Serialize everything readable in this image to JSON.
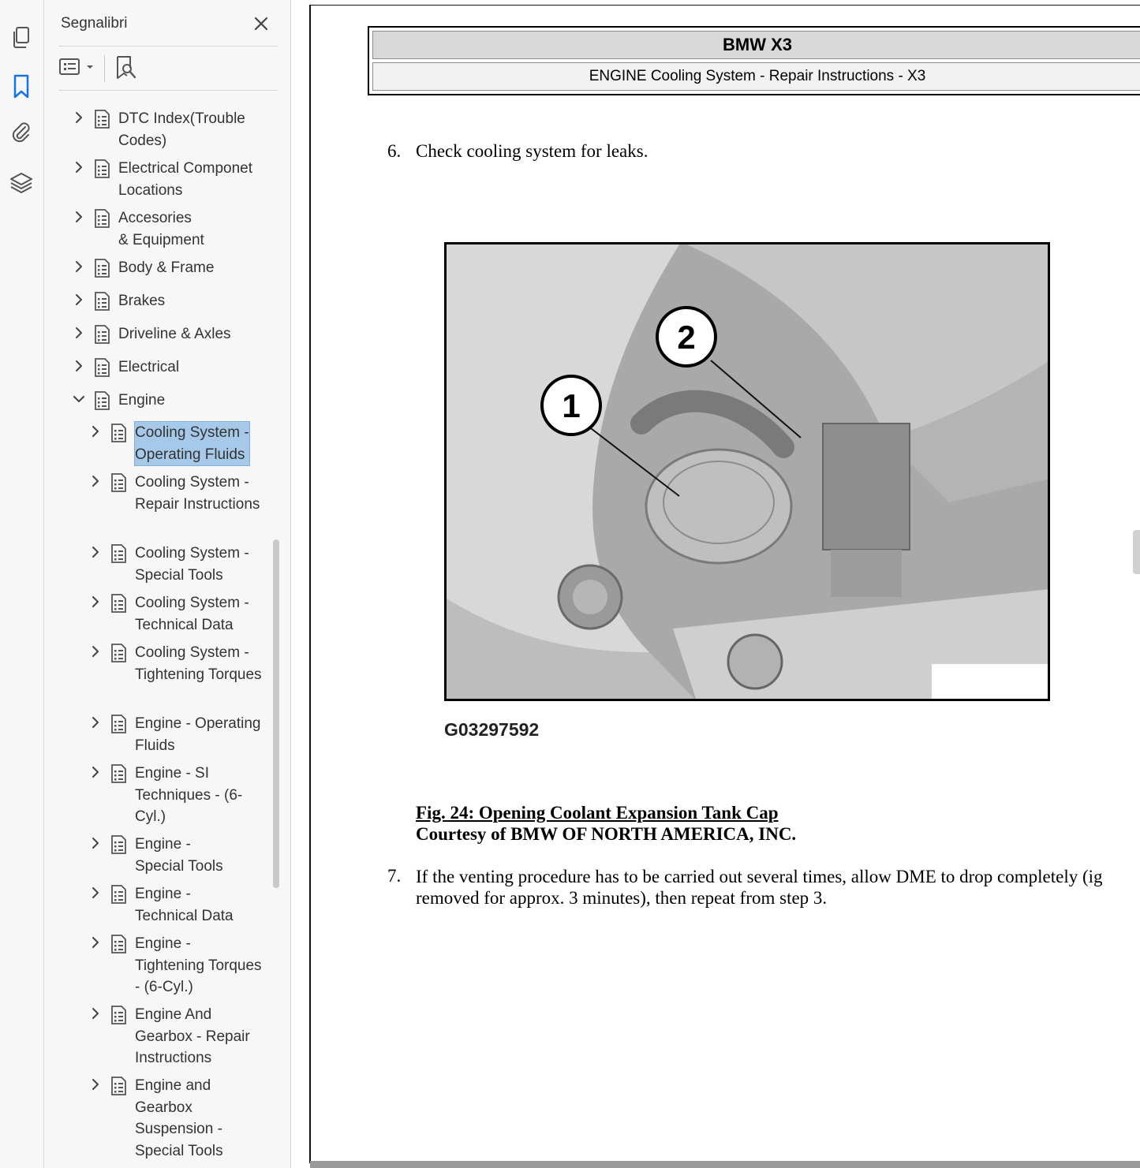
{
  "bookmarks_panel": {
    "title": "Segnalibri",
    "items": [
      {
        "label": "DTC Index(Trouble\nCodes)",
        "expanded": false,
        "selected": false
      },
      {
        "label": "Electrical Componet\nLocations",
        "expanded": false,
        "selected": false
      },
      {
        "label": "Accesories\n& Equipment",
        "expanded": false,
        "selected": false
      },
      {
        "label": "Body & Frame",
        "expanded": false,
        "selected": false
      },
      {
        "label": "Brakes",
        "expanded": false,
        "selected": false
      },
      {
        "label": "Driveline & Axles",
        "expanded": false,
        "selected": false
      },
      {
        "label": "Electrical",
        "expanded": false,
        "selected": false
      },
      {
        "label": "Engine",
        "expanded": true,
        "selected": false
      },
      {
        "label": "Cooling System -\nOperating Fluids",
        "expanded": false,
        "selected": true
      },
      {
        "label": "Cooling System -\nRepair Instructions",
        "expanded": false,
        "selected": false
      },
      {
        "label": "Cooling System -\nSpecial Tools",
        "expanded": false,
        "selected": false
      },
      {
        "label": "Cooling System -\nTechnical Data",
        "expanded": false,
        "selected": false
      },
      {
        "label": "Cooling System -\nTightening Torques",
        "expanded": false,
        "selected": false
      },
      {
        "label": "Engine - Operating\nFluids",
        "expanded": false,
        "selected": false
      },
      {
        "label": "Engine - SI\nTechniques - (6-\nCyl.)",
        "expanded": false,
        "selected": false
      },
      {
        "label": "Engine -\nSpecial Tools",
        "expanded": false,
        "selected": false
      },
      {
        "label": "Engine -\nTechnical Data",
        "expanded": false,
        "selected": false
      },
      {
        "label": "Engine -\nTightening Torques\n- (6-Cyl.)",
        "expanded": false,
        "selected": false
      },
      {
        "label": "Engine And\nGearbox - Repair\nInstructions",
        "expanded": false,
        "selected": false
      },
      {
        "label": "Engine and\nGearbox\nSuspension -\nSpecial Tools",
        "expanded": false,
        "selected": false
      }
    ]
  },
  "document": {
    "header_title": "BMW X3",
    "header_subtitle": "ENGINE Cooling System - Repair Instructions - X3",
    "step6_number": "6.",
    "step6_text": "Check cooling system for leaks.",
    "figure_callouts": [
      "1",
      "2"
    ],
    "figure_id": "G03297592",
    "figure_caption": "Fig. 24: Opening Coolant Expansion Tank Cap",
    "figure_credit": "Courtesy of BMW OF NORTH AMERICA, INC.",
    "step7_number": "7.",
    "step7_line1": "If the venting procedure has to be carried out several times, allow DME to drop completely (ig",
    "step7_line2": "removed for approx. 3 minutes), then repeat from step 3."
  },
  "colors": {
    "selection": "#a6c9ea",
    "active_icon": "#1473e6",
    "panel_bg": "#f7f7f7"
  },
  "icons": {
    "rail": [
      "pages-icon",
      "bookmark-icon",
      "attachment-icon",
      "layers-icon"
    ],
    "panel": [
      "close-icon",
      "options-icon",
      "find-bookmark-icon"
    ]
  }
}
